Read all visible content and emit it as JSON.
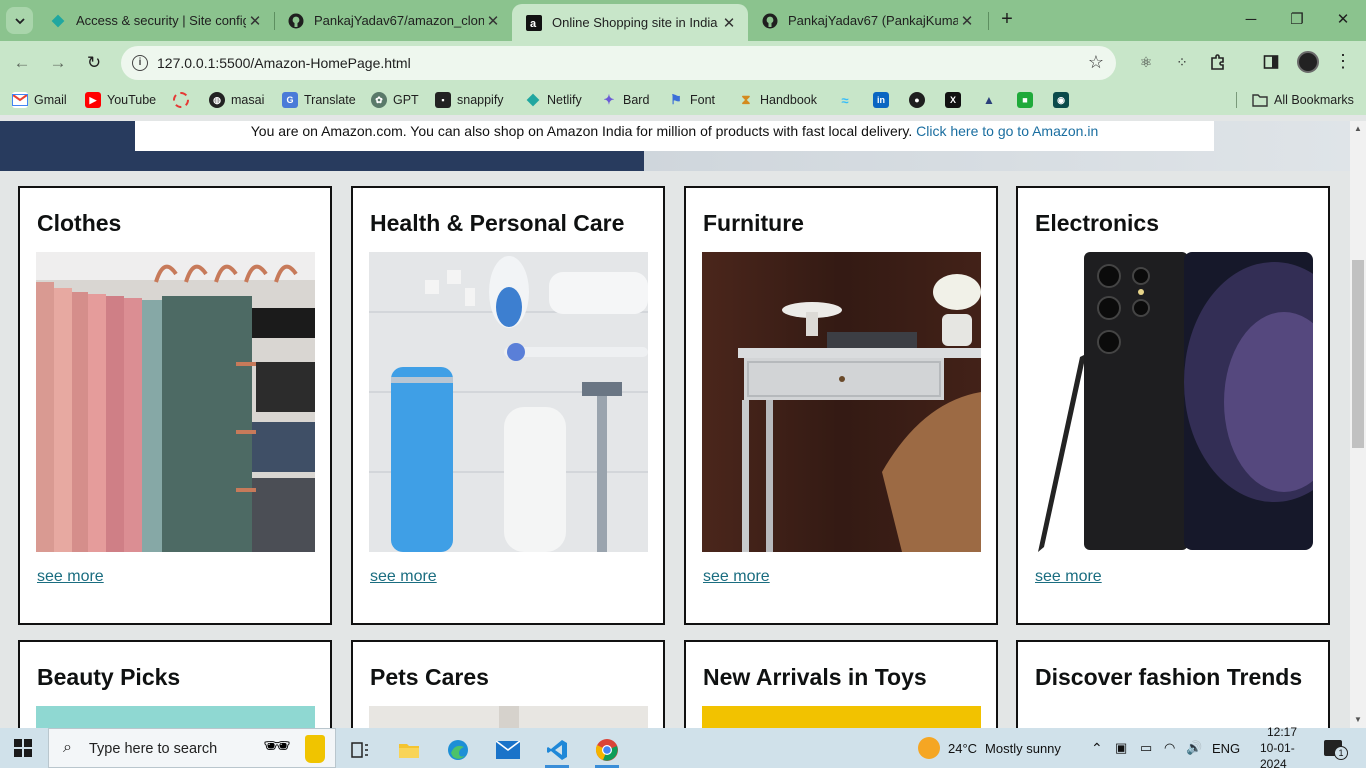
{
  "browser": {
    "tabs": [
      {
        "title": "Access & security | Site configu",
        "favicon": "netlify-icon",
        "active": false
      },
      {
        "title": "PankajYadav67/amazon_clone",
        "favicon": "github-icon",
        "active": false
      },
      {
        "title": "Online Shopping site in India",
        "favicon": "amazon-icon",
        "active": true
      },
      {
        "title": "PankajYadav67 (PankajKumar Ya",
        "favicon": "github-icon",
        "active": false
      }
    ],
    "url": "127.0.0.1:5500/Amazon-HomePage.html",
    "bookmarks": [
      {
        "label": "Gmail",
        "icon": "gmail-icon"
      },
      {
        "label": "YouTube",
        "icon": "youtube-icon"
      },
      {
        "label": "",
        "icon": "red-circle-icon"
      },
      {
        "label": "masai",
        "icon": "globe-icon"
      },
      {
        "label": "Translate",
        "icon": "translate-icon"
      },
      {
        "label": "GPT",
        "icon": "openai-icon"
      },
      {
        "label": "snappify",
        "icon": "snappify-icon"
      },
      {
        "label": "Netlify",
        "icon": "netlify-icon"
      },
      {
        "label": "Bard",
        "icon": "bard-icon"
      },
      {
        "label": "Font",
        "icon": "flag-icon"
      },
      {
        "label": "Handbook",
        "icon": "hourglass-icon"
      }
    ],
    "all_bookmarks": "All Bookmarks"
  },
  "page": {
    "notice_text": "You are on Amazon.com. You can also shop on Amazon India for million of products with fast local delivery.",
    "notice_link": "Click here to go to Amazon.in",
    "cards": [
      {
        "title": "Clothes",
        "link": "see more",
        "image": "clothes-image"
      },
      {
        "title": "Health & Personal Care",
        "link": "see more",
        "image": "health-image"
      },
      {
        "title": "Furniture",
        "link": "see more",
        "image": "furniture-image"
      },
      {
        "title": "Electronics",
        "link": "see more",
        "image": "electronics-image"
      },
      {
        "title": "Beauty Picks",
        "image": "beauty-image"
      },
      {
        "title": "Pets Cares",
        "image": "pets-image"
      },
      {
        "title": "New Arrivals in Toys",
        "image": "toys-image"
      },
      {
        "title": "Discover fashion Trends",
        "image": "fashion-image"
      }
    ]
  },
  "taskbar": {
    "search_placeholder": "Type here to search",
    "weather_temp": "24°C",
    "weather_desc": "Mostly sunny",
    "language": "ENG",
    "time": "12:17",
    "date": "10-01-2024",
    "notification_count": "1"
  },
  "colors": {
    "tabstrip": "#8bc38e",
    "toolbar": "#c8e6c9",
    "link": "#1a6d80",
    "hero_navy": "#283b5e"
  }
}
